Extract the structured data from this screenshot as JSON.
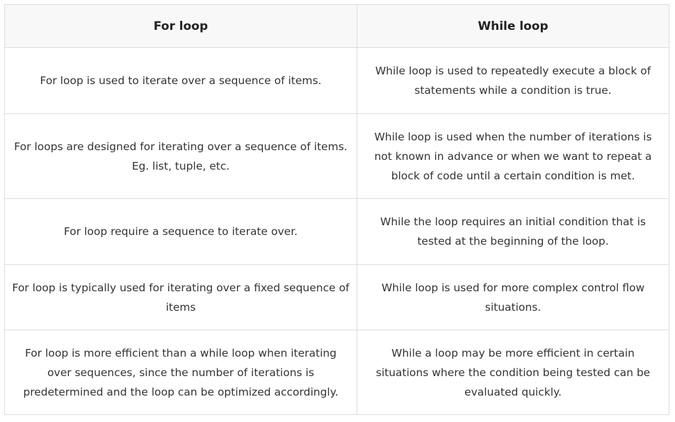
{
  "table": {
    "headers": [
      "For loop",
      "While loop"
    ],
    "rows": [
      [
        "For loop is used to iterate over a sequence of items.",
        "While loop is used to repeatedly execute a block of statements while a condition is true."
      ],
      [
        "For loops are designed for iterating over a sequence of items. Eg. list, tuple, etc.",
        "While loop is used when the number of iterations is not known in advance or when we want to repeat a block of code until a certain condition is met."
      ],
      [
        "For loop require a sequence to iterate over.",
        "While the loop requires an initial condition that is tested at the beginning of the loop."
      ],
      [
        "For loop is typically used for iterating over a fixed sequence of items",
        "While loop is used for more complex control flow situations."
      ],
      [
        "For loop is more efficient than a while loop when iterating over sequences, since the number of iterations is predetermined and the loop can be optimized accordingly.",
        "While a loop may be more efficient in certain situations where the condition being tested can be evaluated quickly."
      ]
    ]
  }
}
